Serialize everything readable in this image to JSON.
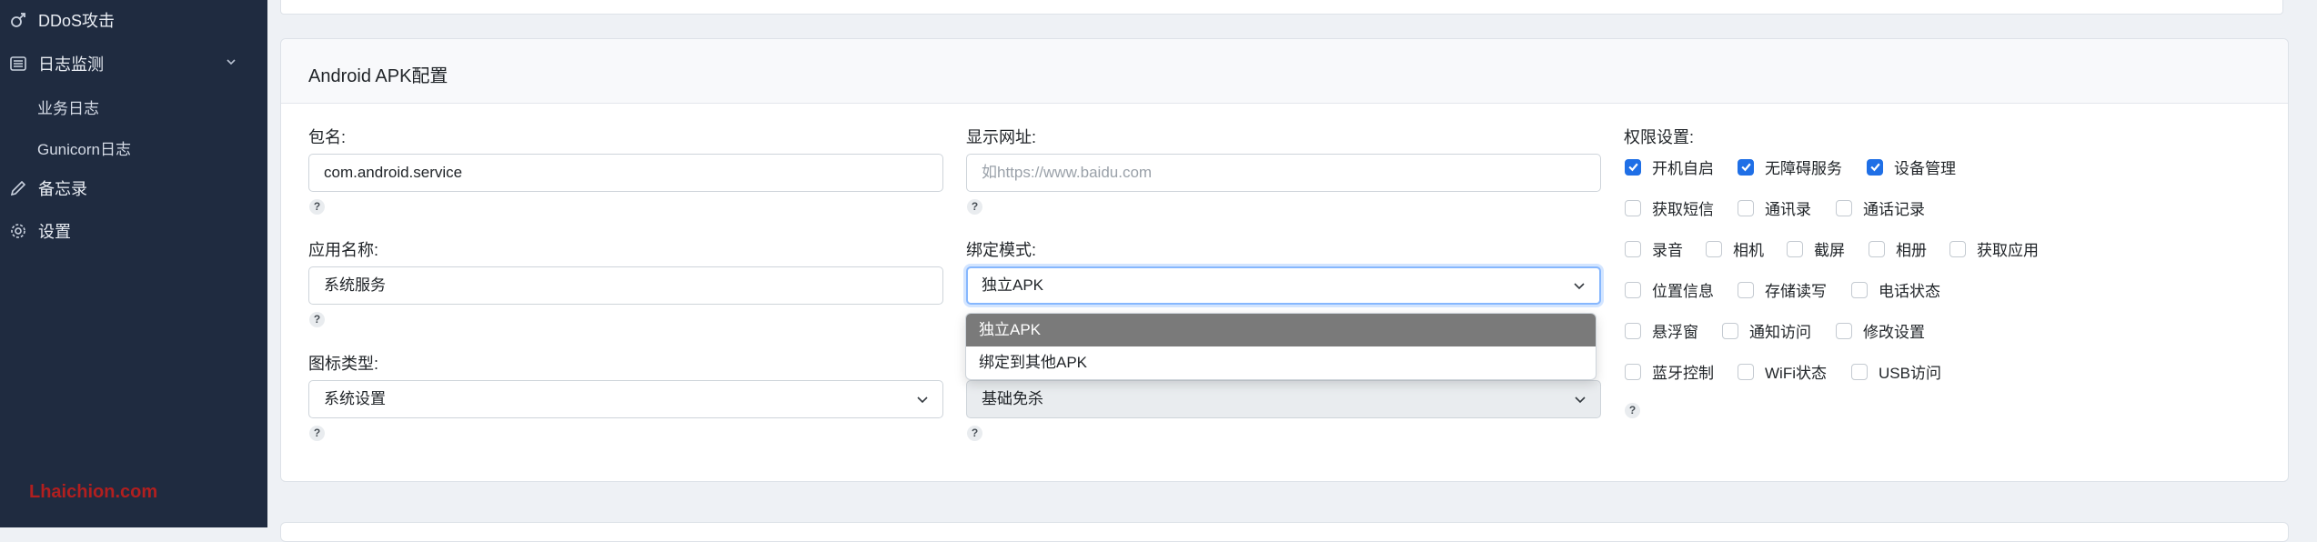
{
  "sidebar": {
    "items": [
      {
        "label": "DDoS攻击",
        "icon": "gender-icon"
      },
      {
        "label": "日志监测",
        "icon": "list-icon"
      },
      {
        "label": "备忘录",
        "icon": "pencil-icon"
      },
      {
        "label": "设置",
        "icon": "gear-icon"
      }
    ],
    "subitems": [
      "业务日志",
      "Gunicorn日志"
    ],
    "watermark": "Lhaichion.com"
  },
  "card": {
    "title": "Android APK配置"
  },
  "form": {
    "package_label": "包名:",
    "package_value": "com.android.service",
    "url_label": "显示网址:",
    "url_placeholder": "如https://www.baidu.com",
    "app_name_label": "应用名称:",
    "app_name_value": "系统服务",
    "bind_mode_label": "绑定模式:",
    "bind_mode_value": "独立APK",
    "icon_type_label": "图标类型:",
    "icon_type_value": "系统设置",
    "av_value": "基础免杀",
    "help": "?",
    "bind_mode_options": [
      "独立APK",
      "绑定到其他APK"
    ]
  },
  "permissions": {
    "label": "权限设置:",
    "rows": [
      [
        {
          "label": "开机自启",
          "checked": true
        },
        {
          "label": "无障碍服务",
          "checked": true
        },
        {
          "label": "设备管理",
          "checked": true
        }
      ],
      [
        {
          "label": "获取短信",
          "checked": false
        },
        {
          "label": "通讯录",
          "checked": false
        },
        {
          "label": "通话记录",
          "checked": false
        }
      ],
      [
        {
          "label": "录音",
          "checked": false
        },
        {
          "label": "相机",
          "checked": false
        },
        {
          "label": "截屏",
          "checked": false
        },
        {
          "label": "相册",
          "checked": false
        },
        {
          "label": "获取应用",
          "checked": false
        }
      ],
      [
        {
          "label": "位置信息",
          "checked": false
        },
        {
          "label": "存储读写",
          "checked": false
        },
        {
          "label": "电话状态",
          "checked": false
        }
      ],
      [
        {
          "label": "悬浮窗",
          "checked": false
        },
        {
          "label": "通知访问",
          "checked": false
        },
        {
          "label": "修改设置",
          "checked": false
        }
      ],
      [
        {
          "label": "蓝牙控制",
          "checked": false
        },
        {
          "label": "WiFi状态",
          "checked": false
        },
        {
          "label": "USB访问",
          "checked": false
        }
      ]
    ]
  },
  "colors": {
    "sidebar_bg": "#1f2b40",
    "accent": "#1f6fe6",
    "selected_option_bg": "#7a7a7a"
  }
}
